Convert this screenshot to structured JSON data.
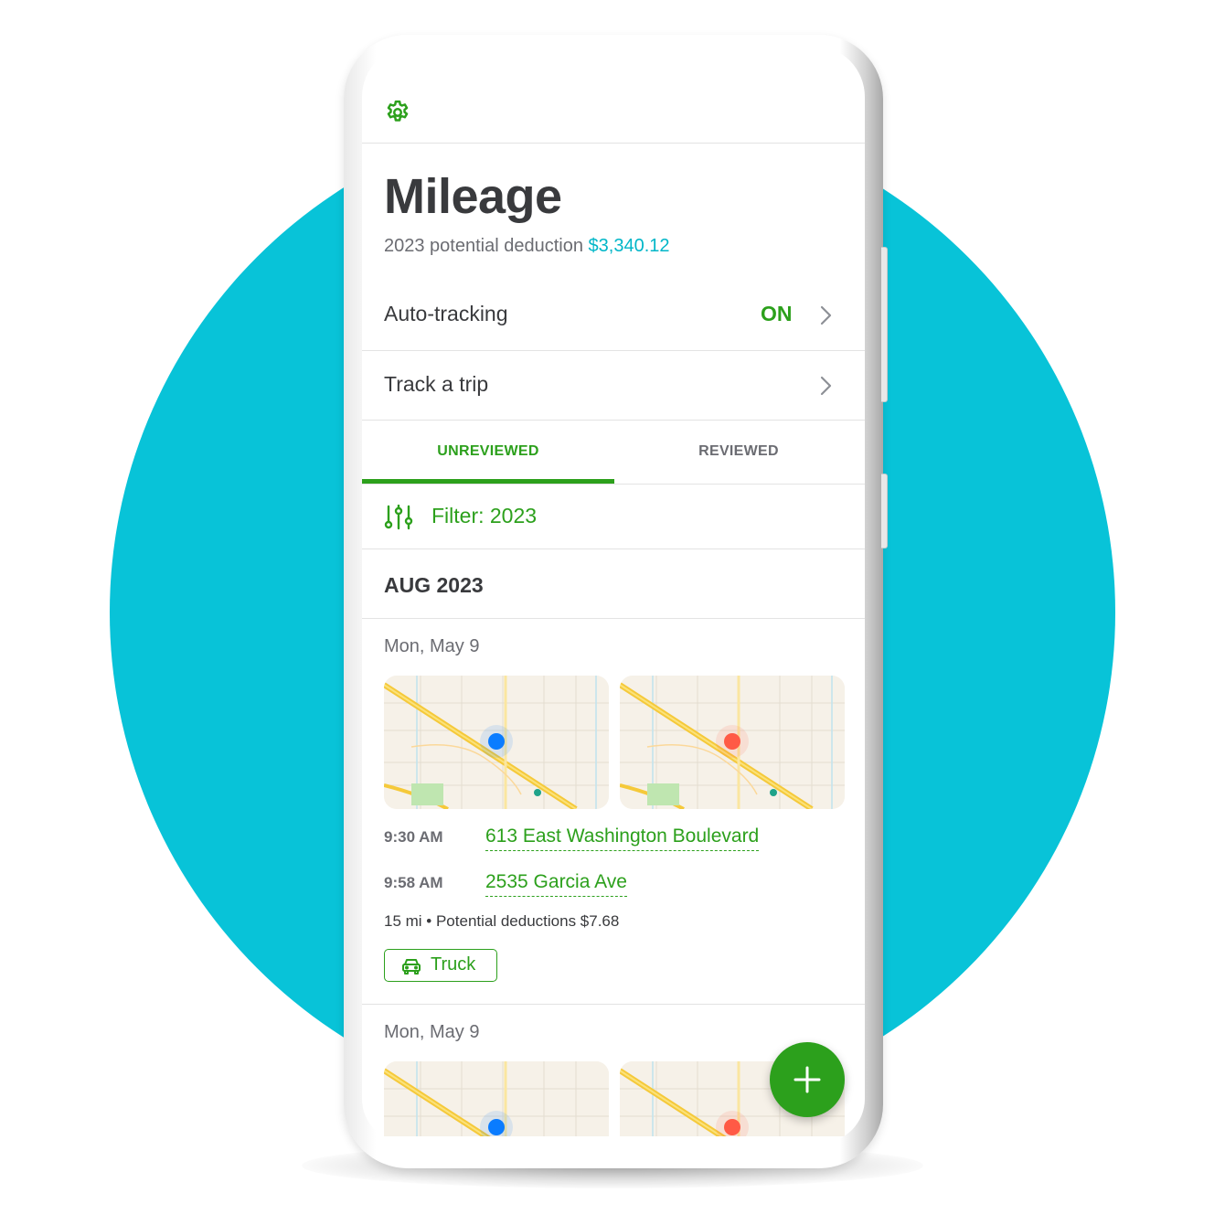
{
  "header": {
    "settings_icon": "gear-icon",
    "title": "Mileage",
    "subtitle_prefix": "2023 potential deduction",
    "subtitle_amount": "$3,340.12"
  },
  "settings_rows": [
    {
      "label": "Auto-tracking",
      "value": "ON",
      "icon": "chevron-right-icon"
    },
    {
      "label": "Track a trip",
      "icon": "chevron-right-icon"
    }
  ],
  "tabs": [
    {
      "label": "UNREVIEWED",
      "active": true
    },
    {
      "label": "REVIEWED",
      "active": false
    }
  ],
  "filter": {
    "icon": "sliders-icon",
    "label": "Filter: 2023"
  },
  "section_header": "AUG 2023",
  "trips": [
    {
      "date": "Mon, May 9",
      "start_marker": "blue-pin",
      "end_marker": "red-pin",
      "start_time": "9:30 AM",
      "start_address": "613 East Washington Boulevard",
      "end_time": "9:58 AM",
      "end_address": "2535 Garcia Ave",
      "summary": "15 mi • Potential deductions $7.68",
      "vehicle": {
        "icon": "car-icon",
        "label": "Truck"
      }
    },
    {
      "date": "Mon, May 9",
      "start_marker": "blue-pin",
      "end_marker": "red-pin"
    }
  ],
  "fab": {
    "icon": "plus-icon"
  },
  "colors": {
    "brand_green": "#2ca01c",
    "accent_teal": "#00b6c8",
    "background_circle": "#08c3d8",
    "text_dark": "#393a3d",
    "text_gray": "#6b6c72",
    "start_pin": "#0a7cff",
    "end_pin": "#ff5a45"
  }
}
